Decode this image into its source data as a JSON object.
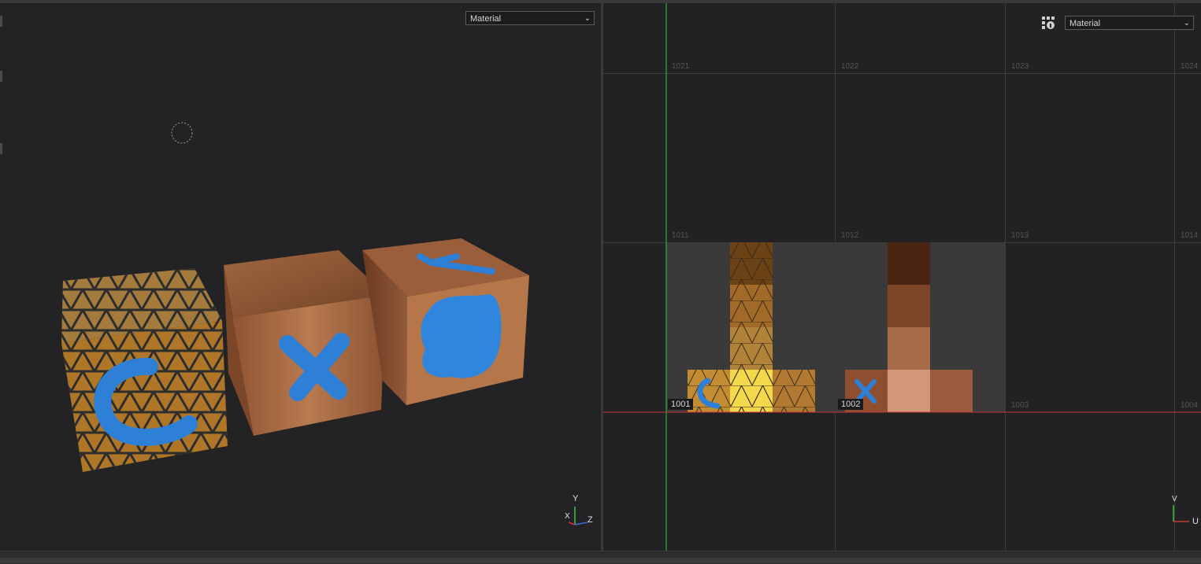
{
  "viewport3d": {
    "mode_select": {
      "value": "Material"
    },
    "gizmo": {
      "y": "Y",
      "x": "X",
      "z": "Z"
    },
    "cubes": [
      {
        "glyph": "C"
      },
      {
        "glyph": "X"
      },
      {
        "glyph": "blob"
      }
    ]
  },
  "uv_editor": {
    "mode_select": {
      "value": "Material"
    },
    "settings_icon": "grid-settings-icon",
    "tiles_top": [
      "1021",
      "1022",
      "1023",
      "1024"
    ],
    "tiles_mid": [
      "1011",
      "1012",
      "1013",
      "1014"
    ],
    "tiles_bottom": [
      "1001",
      "1002",
      "1003",
      "1004"
    ],
    "axes": {
      "v": "V",
      "u": "U"
    },
    "colors": {
      "u_axis": "#c8373a",
      "v_axis": "#35c43a",
      "uv_highlight": "#3a3a3b"
    }
  }
}
